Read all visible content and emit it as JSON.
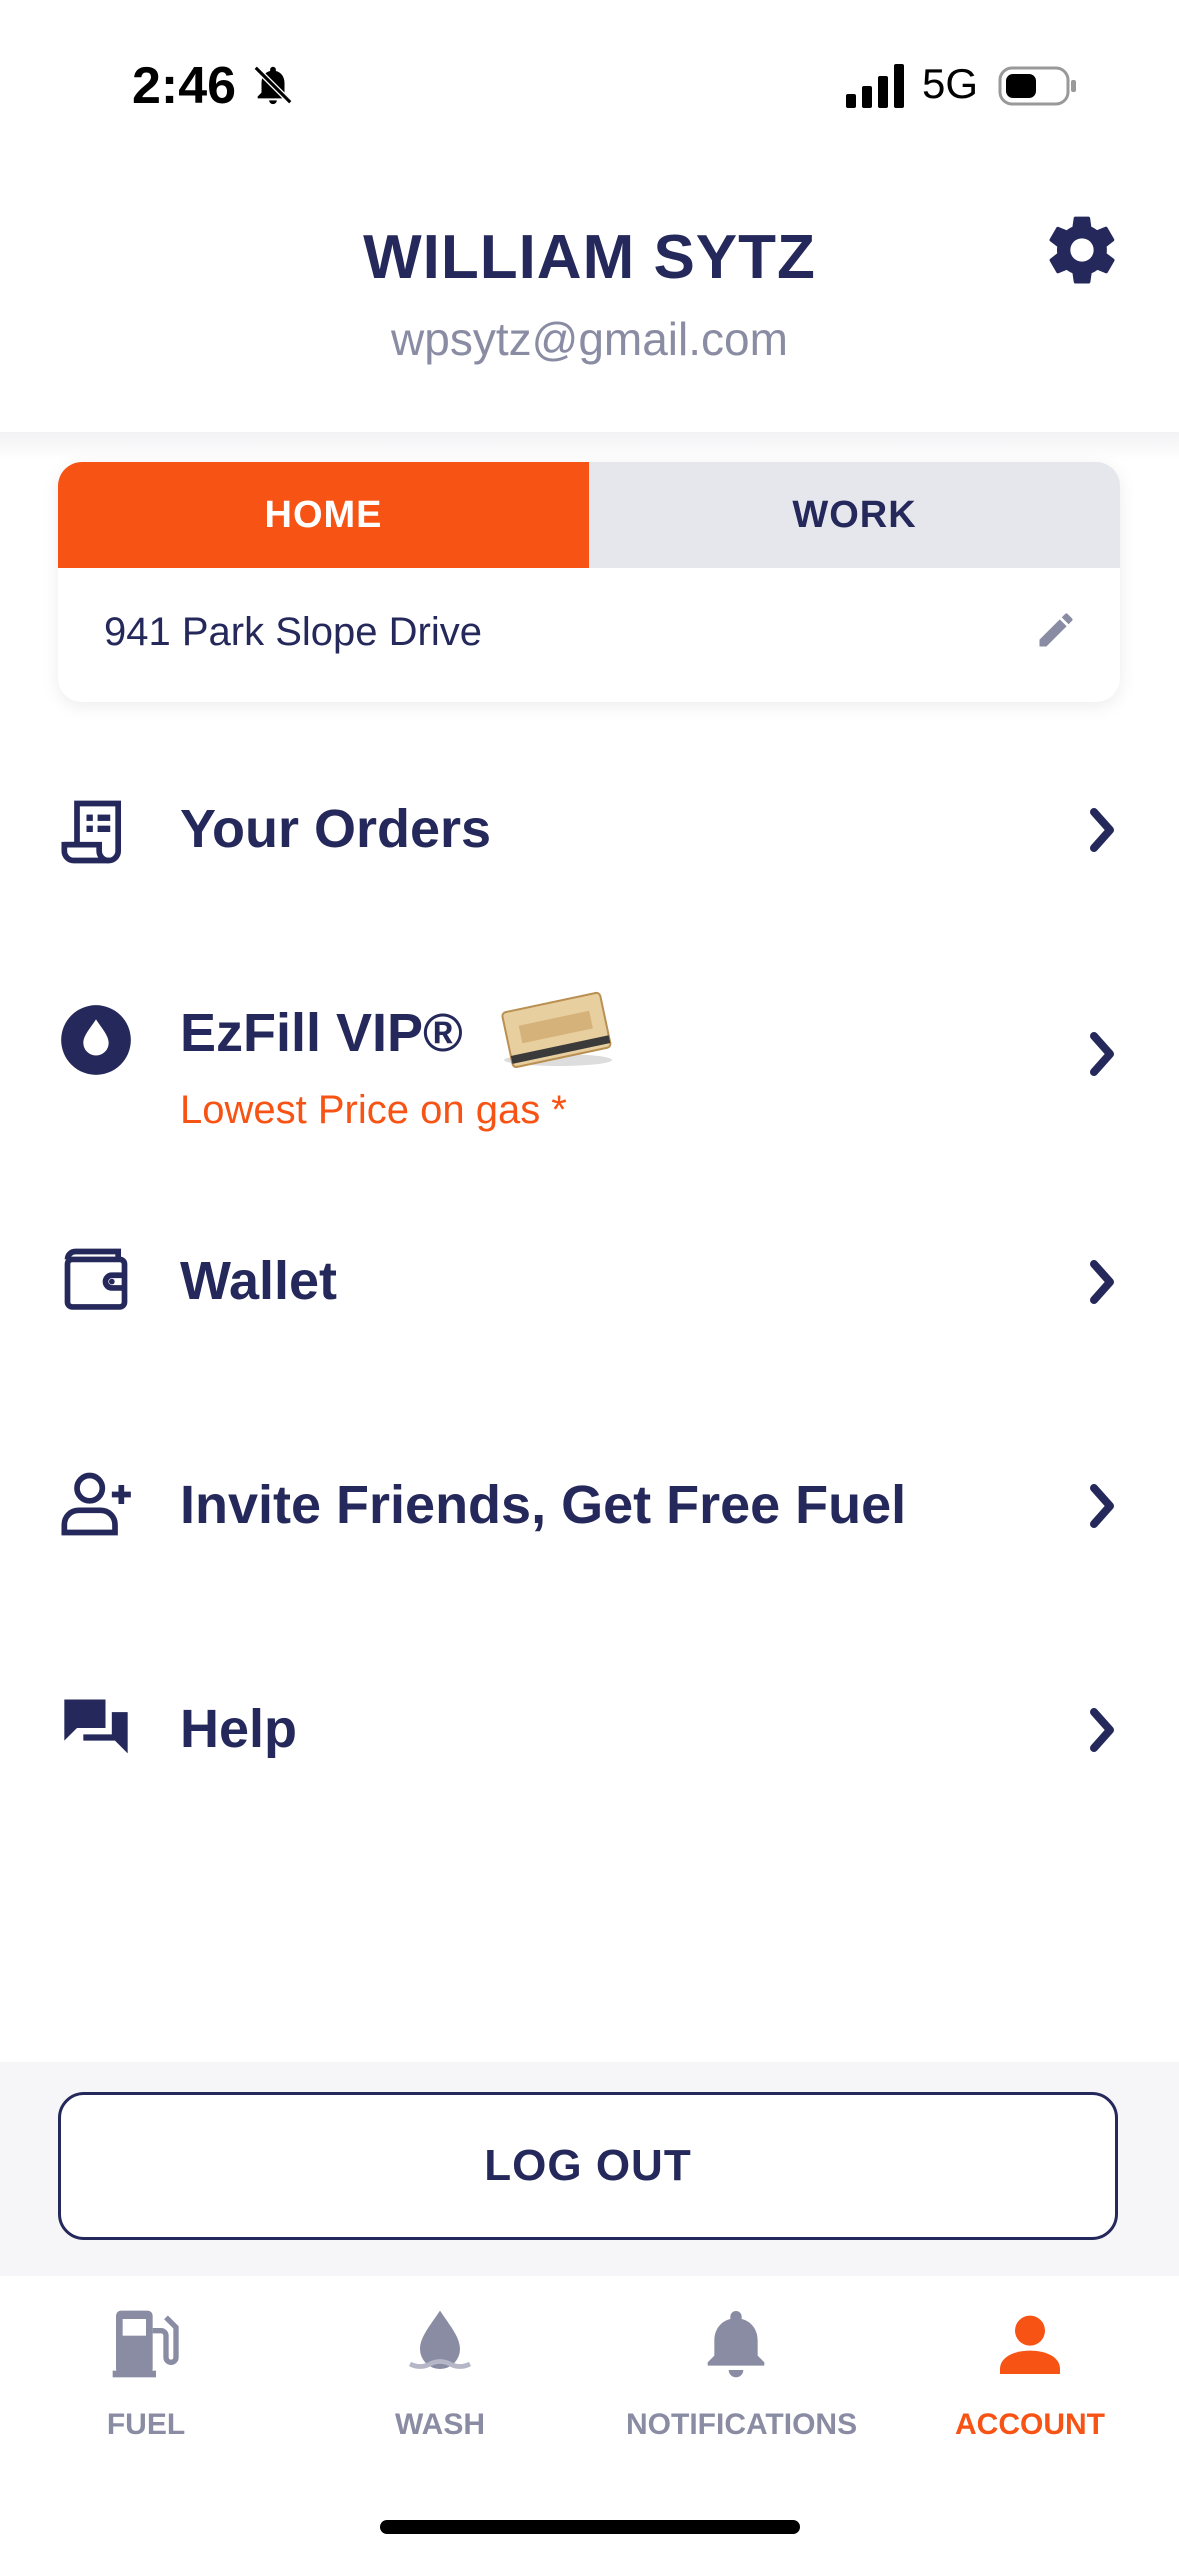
{
  "status_bar": {
    "time": "2:46",
    "network": "5G"
  },
  "profile": {
    "name": "WILLIAM SYTZ",
    "email": "wpsytz@gmail.com"
  },
  "address": {
    "tabs": [
      {
        "label": "HOME",
        "active": true
      },
      {
        "label": "WORK",
        "active": false
      }
    ],
    "current": "941 Park Slope Drive"
  },
  "menu": {
    "orders": "Your Orders",
    "vip": "EzFill VIP®",
    "vip_sub": "Lowest Price on gas *",
    "wallet": "Wallet",
    "invite": "Invite Friends, Get Free Fuel",
    "help": "Help"
  },
  "logout": "LOG OUT",
  "nav": {
    "items": [
      {
        "label": "FUEL",
        "icon": "fuel-pump-icon"
      },
      {
        "label": "WASH",
        "icon": "water-drop-icon"
      },
      {
        "label": "NOTIFICATIONS",
        "icon": "bell-icon"
      },
      {
        "label": "ACCOUNT",
        "icon": "person-icon",
        "active": true
      }
    ]
  },
  "colors": {
    "primary": "#25285a",
    "accent": "#f75314",
    "muted": "#8a8ca3"
  }
}
